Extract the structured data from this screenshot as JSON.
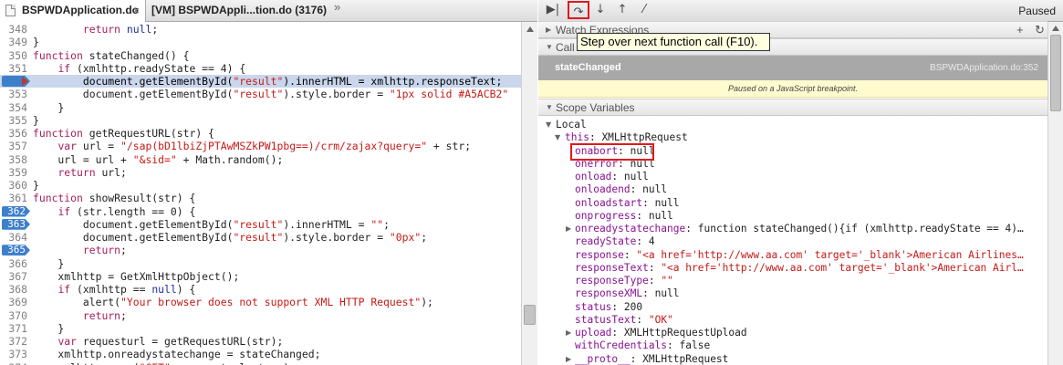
{
  "tabs": [
    {
      "label": "BSPWDApplication.do",
      "close": "×"
    },
    {
      "label": "[VM] BSPWDAppli...tion.do (3176)"
    }
  ],
  "tabs_more": "»",
  "code_lines": [
    {
      "n": "348",
      "t": "        return null;"
    },
    {
      "n": "349",
      "t": "}"
    },
    {
      "n": "350",
      "t": "function stateChanged() {"
    },
    {
      "n": "351",
      "t": "    if (xmlhttp.readyState == 4) {"
    },
    {
      "n": "352",
      "t": "        document.getElementById(\"result\").innerHTML = xmlhttp.responseText;",
      "current": true,
      "breakpoint": true
    },
    {
      "n": "353",
      "t": "        document.getElementById(\"result\").style.border = \"1px solid #A5ACB2\""
    },
    {
      "n": "354",
      "t": "    }"
    },
    {
      "n": "355",
      "t": "}"
    },
    {
      "n": "356",
      "t": "function getRequestURL(str) {"
    },
    {
      "n": "357",
      "t": "    var url = \"/sap(bD1lbiZjPTAwMSZkPW1pbg==)/crm/zajax?query=\" + str;"
    },
    {
      "n": "358",
      "t": "    url = url + \"&sid=\" + Math.random();"
    },
    {
      "n": "359",
      "t": "    return url;"
    },
    {
      "n": "360",
      "t": "}"
    },
    {
      "n": "361",
      "t": "function showResult(str) {"
    },
    {
      "n": "362",
      "t": "    if (str.length == 0) {",
      "breakpoint": true
    },
    {
      "n": "363",
      "t": "        document.getElementById(\"result\").innerHTML = \"\";",
      "breakpoint": true
    },
    {
      "n": "364",
      "t": "        document.getElementById(\"result\").style.border = \"0px\";"
    },
    {
      "n": "365",
      "t": "        return;",
      "breakpoint": true
    },
    {
      "n": "366",
      "t": "    }"
    },
    {
      "n": "367",
      "t": "    xmlhttp = GetXmlHttpObject();"
    },
    {
      "n": "368",
      "t": "    if (xmlhttp == null) {"
    },
    {
      "n": "369",
      "t": "        alert(\"Your browser does not support XML HTTP Request\");"
    },
    {
      "n": "370",
      "t": "        return;"
    },
    {
      "n": "371",
      "t": "    }"
    },
    {
      "n": "372",
      "t": "    var requesturl = getRequestURL(str);"
    },
    {
      "n": "373",
      "t": "    xmlhttp.onreadystatechange = stateChanged;"
    },
    {
      "n": "374",
      "t": "    xmlhttp.open(\"GET\", requesturl, true);"
    }
  ],
  "toolbar": {
    "buttons": [
      {
        "name": "resume-button",
        "icon": "▶|"
      },
      {
        "name": "step-over-button",
        "icon": "↷",
        "highlighted": true
      },
      {
        "name": "step-into-button",
        "icon": "↓"
      },
      {
        "name": "step-out-button",
        "icon": "↑"
      },
      {
        "name": "deactivate-breakpoints-button",
        "icon": "⁄"
      }
    ],
    "status": "Paused"
  },
  "tooltip": "Step over next function call (F10).",
  "sections": {
    "watch": "Watch Expressions",
    "watch_add": "+",
    "watch_refresh": "↻",
    "call": "Call Stack",
    "scope": "Scope Variables"
  },
  "call_frame": {
    "name": "stateChanged",
    "location": "BSPWDApplication.do:352"
  },
  "pause_message": "Paused on a JavaScript breakpoint.",
  "scope": [
    {
      "indent": 0,
      "tw": "▼",
      "name": "Local",
      "sep": "",
      "val": "",
      "vtype": "pv"
    },
    {
      "indent": 1,
      "tw": "▼",
      "name": "this",
      "sep": ": ",
      "val": "XMLHttpRequest",
      "vtype": "pv"
    },
    {
      "indent": 2,
      "tw": "",
      "name": "onabort",
      "sep": ": ",
      "val": "null",
      "vtype": "pv"
    },
    {
      "indent": 2,
      "tw": "",
      "name": "onerror",
      "sep": ": ",
      "val": "null",
      "vtype": "pv"
    },
    {
      "indent": 2,
      "tw": "",
      "name": "onload",
      "sep": ": ",
      "val": "null",
      "vtype": "pv"
    },
    {
      "indent": 2,
      "tw": "",
      "name": "onloadend",
      "sep": ": ",
      "val": "null",
      "vtype": "pv"
    },
    {
      "indent": 2,
      "tw": "",
      "name": "onloadstart",
      "sep": ": ",
      "val": "null",
      "vtype": "pv"
    },
    {
      "indent": 2,
      "tw": "",
      "name": "onprogress",
      "sep": ": ",
      "val": "null",
      "vtype": "pv"
    },
    {
      "indent": 2,
      "tw": "▶",
      "name": "onreadystatechange",
      "sep": ": ",
      "val": "function stateChanged(){if (xmlhttp.readyState == 4)…",
      "vtype": "pv"
    },
    {
      "indent": 2,
      "tw": "",
      "name": "readyState",
      "sep": ": ",
      "val": "4",
      "vtype": "pv"
    },
    {
      "indent": 2,
      "tw": "",
      "name": "response",
      "sep": ": ",
      "val": "\"<a href='http://www.aa.com' target='_blank'>American Airlines…",
      "vtype": "ps"
    },
    {
      "indent": 2,
      "tw": "",
      "name": "responseText",
      "sep": ": ",
      "val": "\"<a href='http://www.aa.com' target='_blank'>American Airl…",
      "vtype": "ps",
      "highlight": true
    },
    {
      "indent": 2,
      "tw": "",
      "name": "responseType",
      "sep": ": ",
      "val": "\"\"",
      "vtype": "ps"
    },
    {
      "indent": 2,
      "tw": "",
      "name": "responseXML",
      "sep": ": ",
      "val": "null",
      "vtype": "pv"
    },
    {
      "indent": 2,
      "tw": "",
      "name": "status",
      "sep": ": ",
      "val": "200",
      "vtype": "pv"
    },
    {
      "indent": 2,
      "tw": "",
      "name": "statusText",
      "sep": ": ",
      "val": "\"OK\"",
      "vtype": "ps"
    },
    {
      "indent": 2,
      "tw": "▶",
      "name": "upload",
      "sep": ": ",
      "val": "XMLHttpRequestUpload",
      "vtype": "pv"
    },
    {
      "indent": 2,
      "tw": "",
      "name": "withCredentials",
      "sep": ": ",
      "val": "false",
      "vtype": "pv"
    },
    {
      "indent": 2,
      "tw": "▶",
      "name": "__proto__",
      "sep": ": ",
      "val": "XMLHttpRequest",
      "vtype": "pv"
    }
  ]
}
